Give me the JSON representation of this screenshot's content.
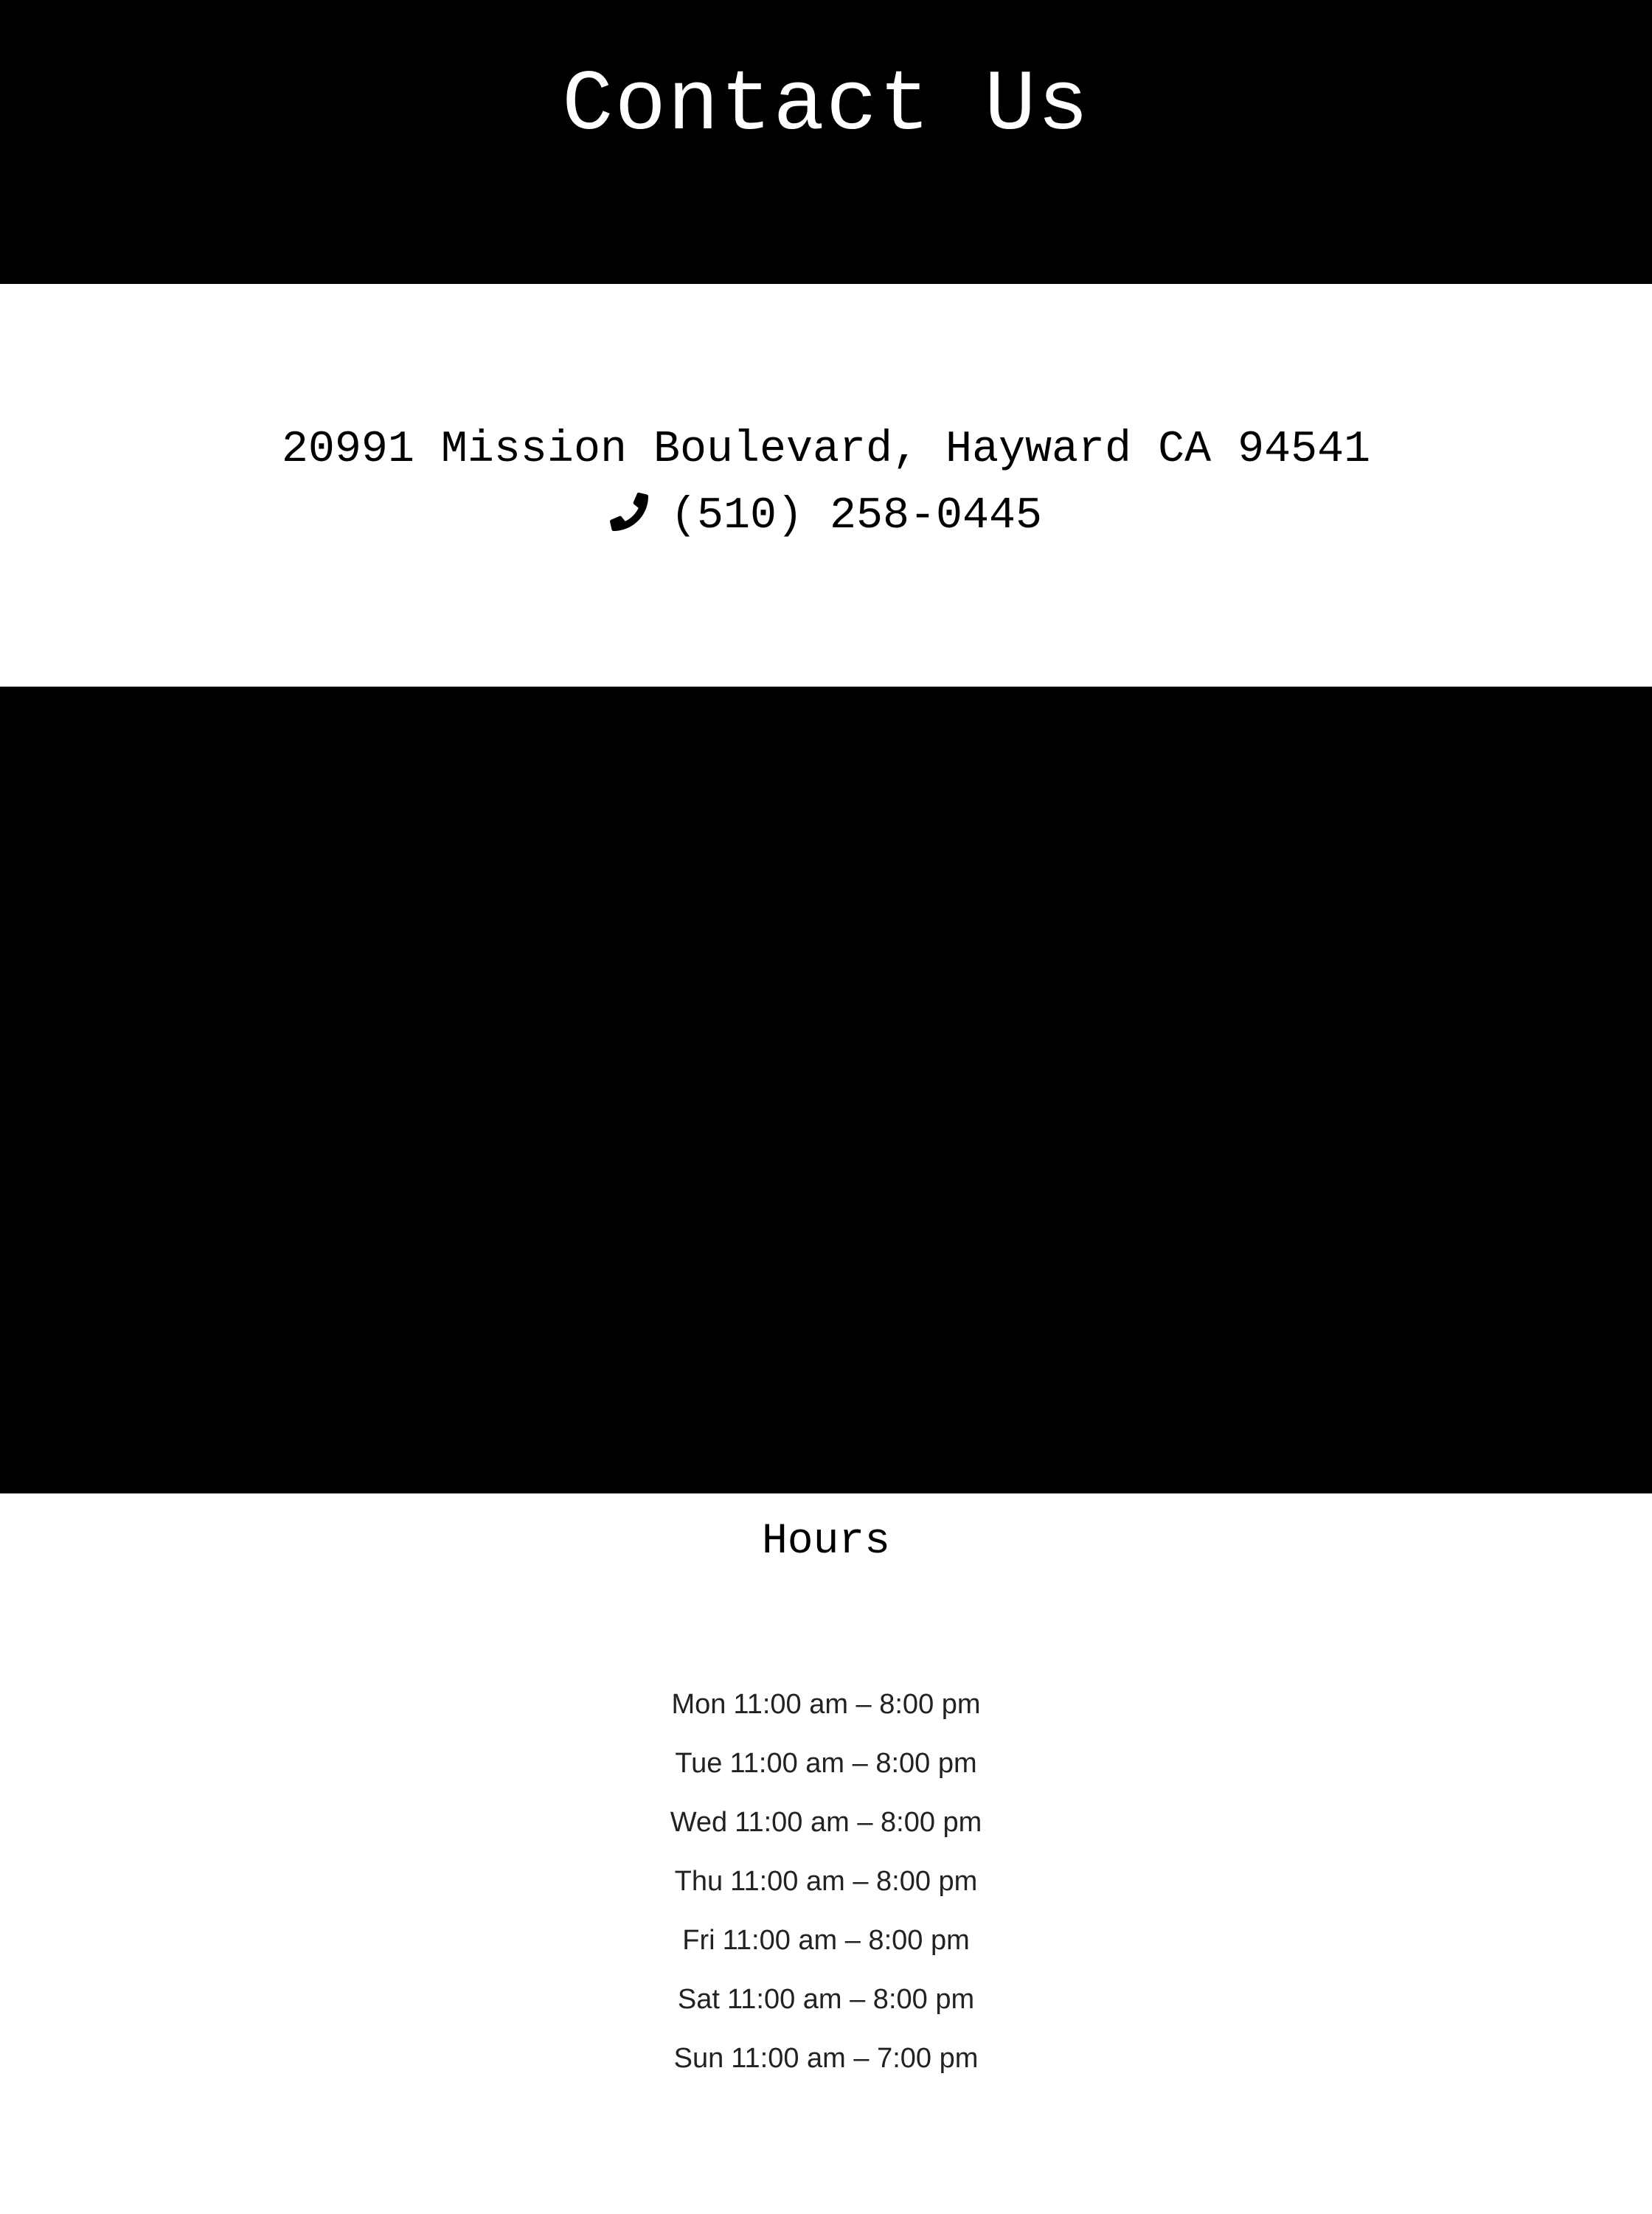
{
  "header": {
    "title": "Contact Us"
  },
  "contact": {
    "address": "20991 Mission Boulevard, Hayward CA 94541",
    "phone_icon": "phone-icon",
    "phone": "(510) 258-0445"
  },
  "hours": {
    "title": "Hours",
    "items": [
      {
        "day": "Mon",
        "time": "11:00 am – 8:00 pm"
      },
      {
        "day": "Tue",
        "time": "11:00 am – 8:00 pm"
      },
      {
        "day": "Wed",
        "time": "11:00 am – 8:00 pm"
      },
      {
        "day": "Thu",
        "time": "11:00 am – 8:00 pm"
      },
      {
        "day": "Fri",
        "time": "11:00 am – 8:00 pm"
      },
      {
        "day": "Sat",
        "time": "11:00 am – 8:00 pm"
      },
      {
        "day": "Sun",
        "time": "11:00 am – 7:00 pm"
      }
    ]
  },
  "colors": {
    "band_background": "#000000",
    "page_background": "#ffffff",
    "text": "#000000"
  }
}
